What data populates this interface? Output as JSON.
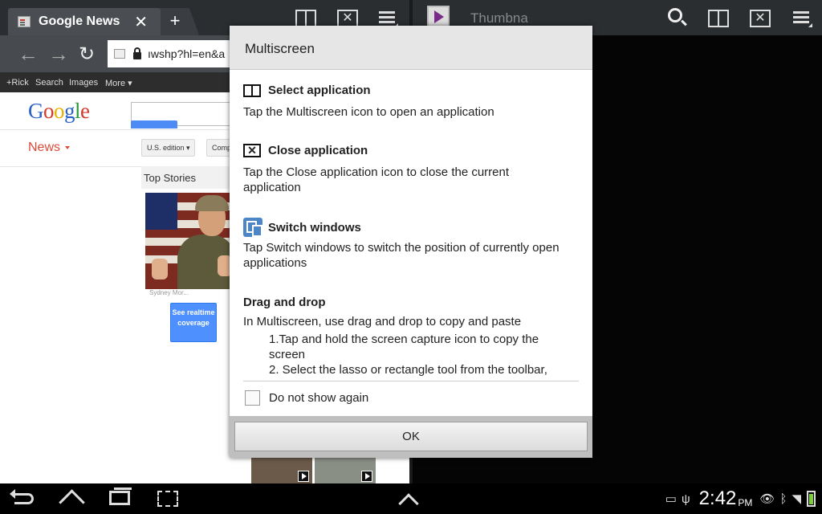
{
  "browser": {
    "tab_title": "Google News",
    "tab_close": "✕",
    "new_tab": "+",
    "url": "ıwshp?hl=en&a",
    "gbar": [
      "+Rick",
      "Search",
      "Images",
      "More ▾"
    ]
  },
  "page": {
    "logo": [
      "G",
      "o",
      "o",
      "g",
      "l",
      "e"
    ],
    "news_label": "News",
    "edition": "U.S. edition ▾",
    "comp": "Comp",
    "top_stories": "Top Stories",
    "caption": "Sydney Mor...",
    "realtime": "See realtime coverage"
  },
  "right_pane": {
    "title": "Thumbna"
  },
  "dialog": {
    "title": "Multiscreen",
    "sections": [
      {
        "heading": "Select application",
        "text": "Tap the Multiscreen icon to open an application"
      },
      {
        "heading": "Close application",
        "text": "Tap the Close application icon to close the current application"
      },
      {
        "heading": "Switch windows",
        "text": "Tap Switch windows to switch the position of currently open applications"
      },
      {
        "heading": "Drag and drop",
        "text": "In Multiscreen, use drag and drop to copy and paste"
      }
    ],
    "dnd_steps": [
      "1.Tap and hold the screen capture icon to copy the screen",
      "2. Select the lasso or rectangle tool from the toolbar,"
    ],
    "checkbox_label": "Do not show again",
    "ok": "OK"
  },
  "status": {
    "time": "2:42",
    "ampm": "PM"
  },
  "colors": {
    "accent_blue": "#4d90fe",
    "news_red": "#dd4b39",
    "battery_green": "#7ccf3a"
  }
}
